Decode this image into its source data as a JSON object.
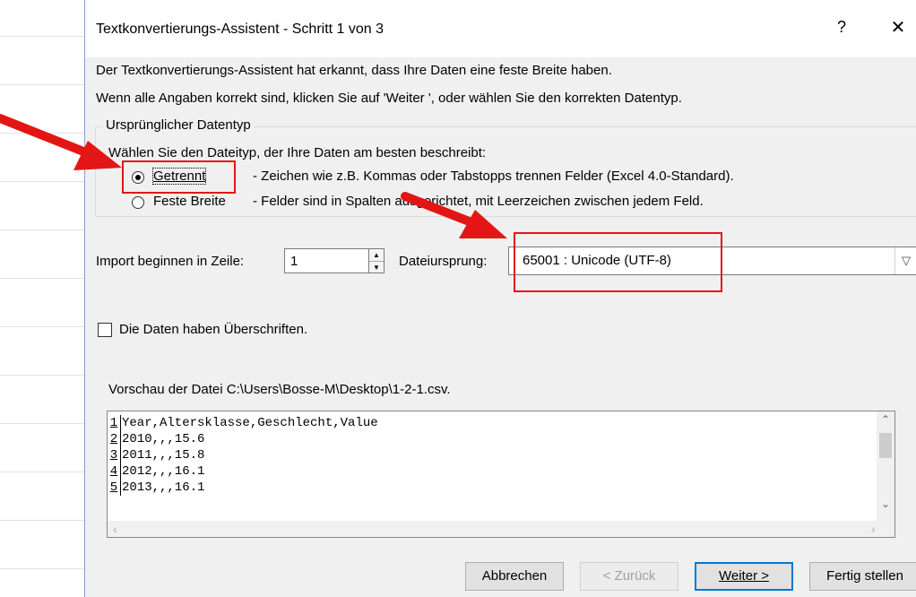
{
  "dialog": {
    "title": "Textkonvertierungs-Assistent - Schritt 1 von 3",
    "help_symbol": "?",
    "close_symbol": "✕"
  },
  "intro": {
    "line1": "Der Textkonvertierungs-Assistent hat erkannt, dass Ihre Daten eine feste Breite haben.",
    "line2": "Wenn alle Angaben korrekt sind, klicken Sie auf 'Weiter ', oder wählen Sie den korrekten Datentyp."
  },
  "datatype_group": {
    "label": "Ursprünglicher Datentyp",
    "prompt": "Wählen Sie den Dateityp, der Ihre Daten am besten beschreibt:",
    "options": [
      {
        "label": "Getrennt",
        "description": "- Zeichen wie z.B. Kommas oder Tabstopps trennen Felder (Excel 4.0-Standard).",
        "selected": true
      },
      {
        "label": "Feste Breite",
        "description": "- Felder sind in Spalten ausgerichtet, mit Leerzeichen zwischen jedem Feld.",
        "selected": false
      }
    ]
  },
  "import_row": {
    "label": "Import beginnen in Zeile:",
    "value": "1"
  },
  "file_origin": {
    "label": "Dateiursprung:",
    "value": "65001 : Unicode (UTF-8)"
  },
  "headers_checkbox": {
    "label": "Die Daten haben Überschriften.",
    "checked": false
  },
  "preview": {
    "label": "Vorschau der Datei C:\\Users\\Bosse-M\\Desktop\\1-2-1.csv.",
    "lines": [
      {
        "num": "1",
        "text": "Year,Altersklasse,Geschlecht,Value"
      },
      {
        "num": "2",
        "text": "2010,,,15.6"
      },
      {
        "num": "3",
        "text": "2011,,,15.8"
      },
      {
        "num": "4",
        "text": "2012,,,16.1"
      },
      {
        "num": "5",
        "text": "2013,,,16.1"
      }
    ]
  },
  "buttons": {
    "cancel": "Abbrechen",
    "back": "< Zurück",
    "next": "Weiter >",
    "finish": "Fertig stellen"
  },
  "colors": {
    "annotation_red": "#e41515",
    "focus_blue": "#0078d7"
  }
}
